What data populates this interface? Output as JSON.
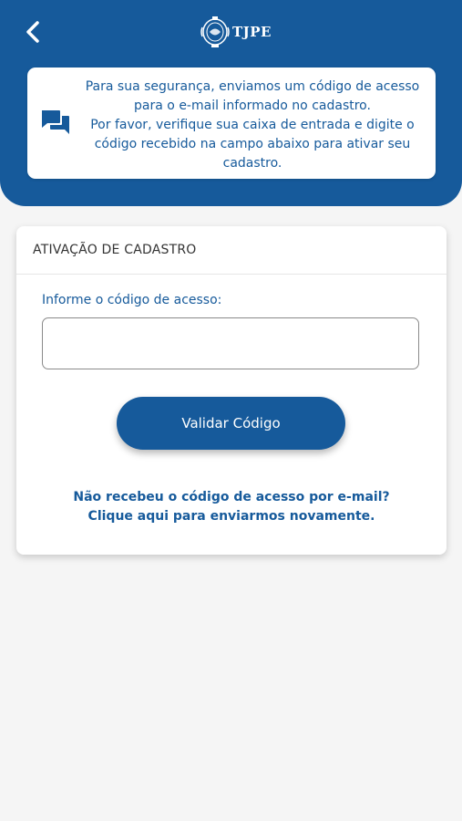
{
  "header": {
    "back_icon": "chevron-left-icon",
    "logo_text": "TJPE",
    "logo_icon": "court-seal-icon"
  },
  "info": {
    "icon": "chat-bubbles-icon",
    "message": "Para sua segurança, enviamos um código de acesso para o e-mail informado no cadastro.\nPor favor, verifique sua caixa de entrada e digite o código recebido na campo abaixo para ativar seu cadastro."
  },
  "card": {
    "title": "ATIVAÇÃO DE CADASTRO",
    "field_label": "Informe o código de acesso:",
    "code_value": "",
    "button_label": "Validar Código",
    "resend_line1": "Não recebeu o código de acesso por e-mail?",
    "resend_line2": "Clique aqui para enviarmos novamente."
  },
  "colors": {
    "primary": "#165a9b",
    "background": "#f5f5f5",
    "card": "#ffffff"
  }
}
